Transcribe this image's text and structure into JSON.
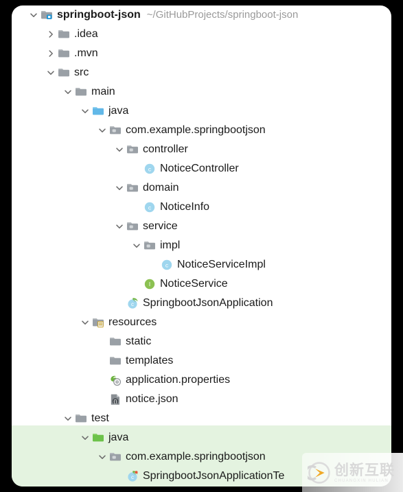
{
  "window": {
    "background_color": "#000000",
    "panel_color": "#ffffff",
    "highlight_color": "#e4f3e0"
  },
  "project": {
    "name": "springboot-json",
    "path": "~/GitHubProjects/springboot-json"
  },
  "colors": {
    "folder_gray": "#9aa0a6",
    "folder_blue": "#62b8e8",
    "folder_green": "#6cc24a",
    "class_blue": "#9fd6ee",
    "interface_green": "#8cc152",
    "text": "#1a1a1a",
    "path_text": "#9a9a9a"
  },
  "tree": {
    "rows": [
      {
        "label": "springboot-json",
        "suffix": "~/GitHubProjects/springboot-json",
        "depth": 0,
        "twisty": "expanded",
        "icon": "module-folder-icon",
        "bold": true,
        "highlight": false
      },
      {
        "label": ".idea",
        "suffix": "",
        "depth": 1,
        "twisty": "collapsed",
        "icon": "folder-gray-icon",
        "bold": false,
        "highlight": false
      },
      {
        "label": ".mvn",
        "suffix": "",
        "depth": 1,
        "twisty": "collapsed",
        "icon": "folder-gray-icon",
        "bold": false,
        "highlight": false
      },
      {
        "label": "src",
        "suffix": "",
        "depth": 1,
        "twisty": "expanded",
        "icon": "folder-gray-icon",
        "bold": false,
        "highlight": false
      },
      {
        "label": "main",
        "suffix": "",
        "depth": 2,
        "twisty": "expanded",
        "icon": "folder-gray-icon",
        "bold": false,
        "highlight": false
      },
      {
        "label": "java",
        "suffix": "",
        "depth": 3,
        "twisty": "expanded",
        "icon": "folder-blue-icon",
        "bold": false,
        "highlight": false
      },
      {
        "label": "com.example.springbootjson",
        "suffix": "",
        "depth": 4,
        "twisty": "expanded",
        "icon": "package-icon",
        "bold": false,
        "highlight": false
      },
      {
        "label": "controller",
        "suffix": "",
        "depth": 5,
        "twisty": "expanded",
        "icon": "package-icon",
        "bold": false,
        "highlight": false
      },
      {
        "label": "NoticeController",
        "suffix": "",
        "depth": 6,
        "twisty": "none",
        "icon": "java-class-icon",
        "bold": false,
        "highlight": false
      },
      {
        "label": "domain",
        "suffix": "",
        "depth": 5,
        "twisty": "expanded",
        "icon": "package-icon",
        "bold": false,
        "highlight": false
      },
      {
        "label": "NoticeInfo",
        "suffix": "",
        "depth": 6,
        "twisty": "none",
        "icon": "java-class-icon",
        "bold": false,
        "highlight": false
      },
      {
        "label": "service",
        "suffix": "",
        "depth": 5,
        "twisty": "expanded",
        "icon": "package-icon",
        "bold": false,
        "highlight": false
      },
      {
        "label": "impl",
        "suffix": "",
        "depth": 6,
        "twisty": "expanded",
        "icon": "package-icon",
        "bold": false,
        "highlight": false
      },
      {
        "label": "NoticeServiceImpl",
        "suffix": "",
        "depth": 7,
        "twisty": "none",
        "icon": "java-class-icon",
        "bold": false,
        "highlight": false
      },
      {
        "label": "NoticeService",
        "suffix": "",
        "depth": 6,
        "twisty": "none",
        "icon": "java-interface-icon",
        "bold": false,
        "highlight": false
      },
      {
        "label": "SpringbootJsonApplication",
        "suffix": "",
        "depth": 5,
        "twisty": "none",
        "icon": "spring-class-icon",
        "bold": false,
        "highlight": false
      },
      {
        "label": "resources",
        "suffix": "",
        "depth": 3,
        "twisty": "expanded",
        "icon": "resources-folder-icon",
        "bold": false,
        "highlight": false
      },
      {
        "label": "static",
        "suffix": "",
        "depth": 4,
        "twisty": "none",
        "icon": "folder-gray-icon",
        "bold": false,
        "highlight": false
      },
      {
        "label": "templates",
        "suffix": "",
        "depth": 4,
        "twisty": "none",
        "icon": "folder-gray-icon",
        "bold": false,
        "highlight": false
      },
      {
        "label": "application.properties",
        "suffix": "",
        "depth": 4,
        "twisty": "none",
        "icon": "spring-properties-icon",
        "bold": false,
        "highlight": false
      },
      {
        "label": "notice.json",
        "suffix": "",
        "depth": 4,
        "twisty": "none",
        "icon": "json-file-icon",
        "bold": false,
        "highlight": false
      },
      {
        "label": "test",
        "suffix": "",
        "depth": 2,
        "twisty": "expanded",
        "icon": "folder-gray-icon",
        "bold": false,
        "highlight": false
      },
      {
        "label": "java",
        "suffix": "",
        "depth": 3,
        "twisty": "expanded",
        "icon": "folder-green-icon",
        "bold": false,
        "highlight": true
      },
      {
        "label": "com.example.springbootjson",
        "suffix": "",
        "depth": 4,
        "twisty": "expanded",
        "icon": "package-icon",
        "bold": false,
        "highlight": true
      },
      {
        "label": "SpringbootJsonApplicationTe",
        "suffix": "",
        "depth": 5,
        "twisty": "none",
        "icon": "spring-test-class-icon",
        "bold": false,
        "highlight": true
      }
    ]
  },
  "watermark": {
    "text": "创新互联",
    "subtext": "CHUANGXIN HULIAN",
    "logo": "cx-logo-icon"
  }
}
